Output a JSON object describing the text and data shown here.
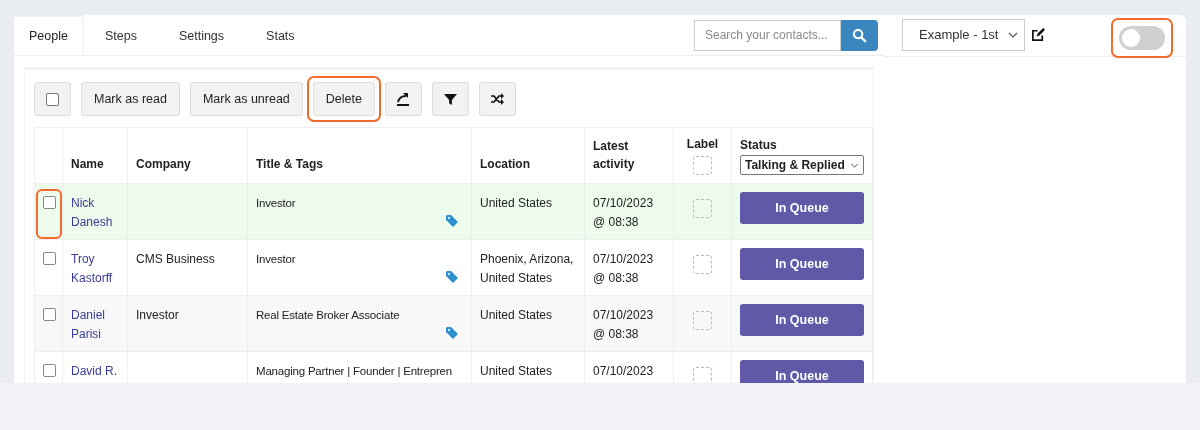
{
  "tabs": [
    {
      "label": "People",
      "selected": true
    },
    {
      "label": "Steps",
      "selected": false
    },
    {
      "label": "Settings",
      "selected": false
    },
    {
      "label": "Stats",
      "selected": false
    }
  ],
  "search": {
    "placeholder": "Search your contacts..."
  },
  "campaign_select": {
    "value": "Example - 1st"
  },
  "toggle": {
    "on": false,
    "annotated": true
  },
  "toolbar": [
    {
      "kind": "checkbox",
      "checked": false,
      "annotated": false
    },
    {
      "kind": "text",
      "label": "Mark as read",
      "annotated": false
    },
    {
      "kind": "text",
      "label": "Mark as unread",
      "annotated": false
    },
    {
      "kind": "text",
      "label": "Delete",
      "annotated": true
    },
    {
      "kind": "export",
      "annotated": false
    },
    {
      "kind": "filter",
      "annotated": false
    },
    {
      "kind": "shuffle",
      "annotated": false
    }
  ],
  "table": {
    "columns": [
      "Name",
      "Company",
      "Title & Tags",
      "Location",
      "Latest activity",
      "Label",
      "Status"
    ],
    "status_filter": "Talking & Replied",
    "rows": [
      {
        "name": "Nick Danesh",
        "company": "",
        "title": "Investor",
        "tagged": true,
        "location": "United States",
        "activity": "07/10/2023 @ 08:38",
        "status": "In Queue",
        "checked": false,
        "hovered": true,
        "annotated": true
      },
      {
        "name": "Troy Kastorff",
        "company": "CMS Business",
        "title": "Investor",
        "tagged": true,
        "location": "Phoenix, Arizona, United States",
        "activity": "07/10/2023 @ 08:38",
        "status": "In Queue",
        "checked": false,
        "hovered": false,
        "annotated": false
      },
      {
        "name": "Daniel Parisi",
        "company": "Investor",
        "title": "Real Estate Broker Associate",
        "tagged": true,
        "location": "United States",
        "activity": "07/10/2023 @ 08:38",
        "status": "In Queue",
        "checked": false,
        "hovered": false,
        "annotated": false
      },
      {
        "name": "David R.",
        "company": "",
        "title": "Managing Partner | Founder | Entrepren",
        "tagged": false,
        "location": "United States",
        "activity": "07/10/2023",
        "status": "In Queue",
        "checked": false,
        "hovered": false,
        "annotated": false
      }
    ]
  }
}
